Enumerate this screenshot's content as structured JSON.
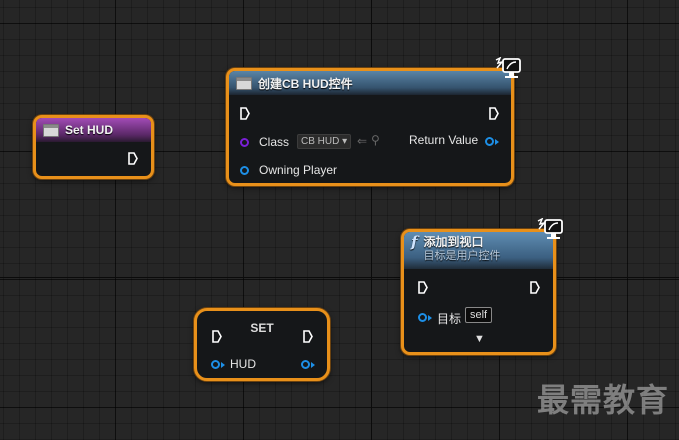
{
  "nodes": {
    "set_hud": {
      "title": "Set HUD"
    },
    "create_widget": {
      "title": "创建CB HUD控件",
      "class_label": "Class",
      "class_value": "CB HUD",
      "return_label": "Return Value",
      "owning_label": "Owning Player"
    },
    "add_viewport": {
      "title": "添加到视口",
      "subtitle": "目标是用户控件",
      "target_label": "目标",
      "target_value": "self",
      "function_glyph": "f"
    },
    "set": {
      "title": "SET",
      "hud_label": "HUD"
    }
  },
  "watermark": "最需教育",
  "colors": {
    "node_border": "#e8901a",
    "exec_pin": "#ffffff",
    "object_pin": "#1d8fe6",
    "class_pin": "#7a1fd6",
    "set_hud_header": "#a24bb6",
    "widget_header": "#35536e"
  }
}
